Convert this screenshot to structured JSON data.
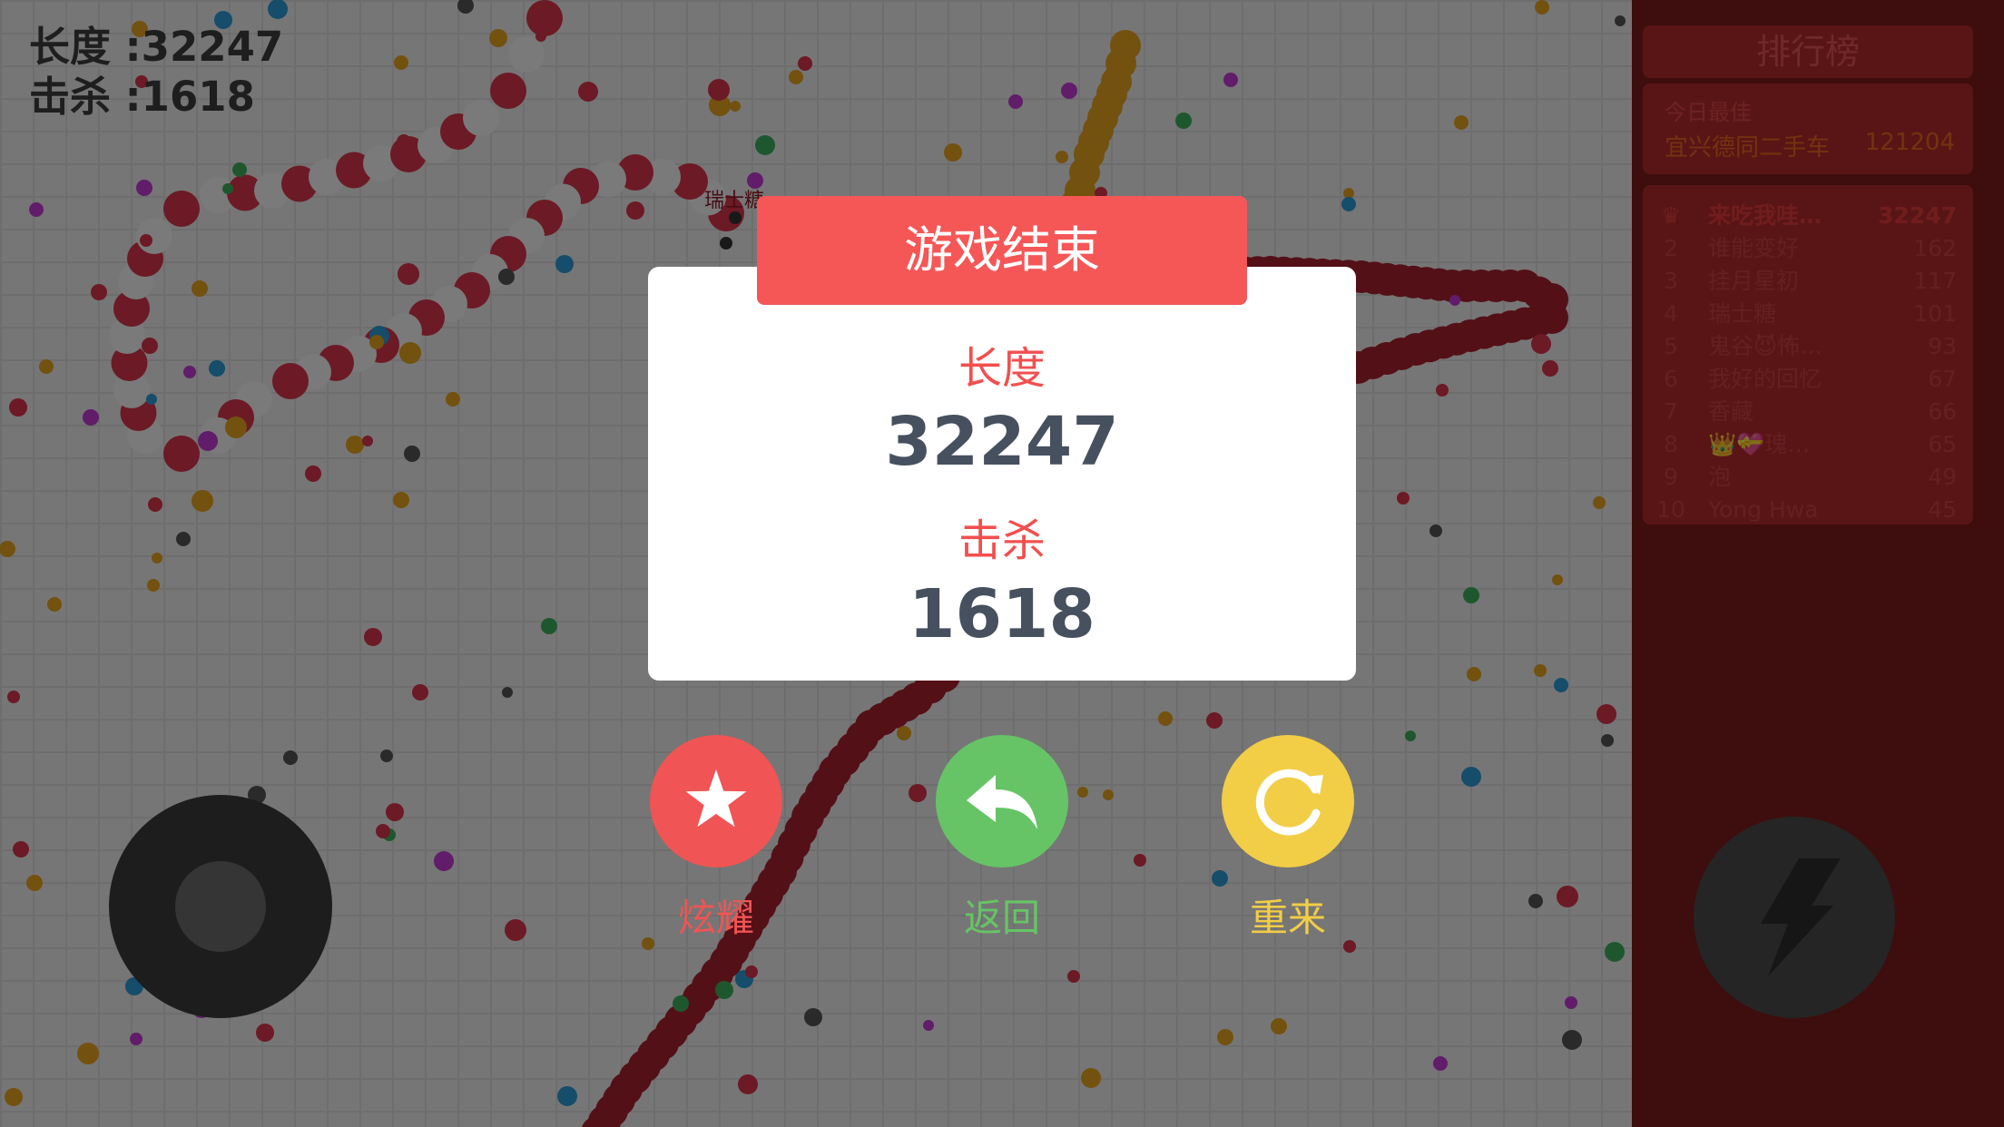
{
  "hud": {
    "length_label": "长度 :32247",
    "kills_label": "击杀 :1618"
  },
  "snake_name_tag": "瑞士糖",
  "leaderboard": {
    "title": "排行榜",
    "today_label": "今日最佳",
    "today_name": "宜兴德同二手车",
    "today_score": "121204",
    "entries": [
      {
        "rank": "1",
        "name": "来吃我哇…",
        "score": "32247"
      },
      {
        "rank": "2",
        "name": "谁能变好",
        "score": "162"
      },
      {
        "rank": "3",
        "name": "挂月星初",
        "score": "117"
      },
      {
        "rank": "4",
        "name": "瑞士糖",
        "score": "101"
      },
      {
        "rank": "5",
        "name": "鬼谷😈怖…",
        "score": "93"
      },
      {
        "rank": "6",
        "name": "我好的回忆",
        "score": "67"
      },
      {
        "rank": "7",
        "name": "香藏",
        "score": "66"
      },
      {
        "rank": "8",
        "name": "👑💝瑰…",
        "score": "65"
      },
      {
        "rank": "9",
        "name": "泡",
        "score": "49"
      },
      {
        "rank": "10",
        "name": "Yong Hwa",
        "score": "45"
      }
    ]
  },
  "result": {
    "title": "游戏结束",
    "length_label": "长度",
    "length_value": "32247",
    "kills_label": "击杀",
    "kills_value": "1618"
  },
  "actions": {
    "show_off": "炫耀",
    "back": "返回",
    "retry": "重来"
  },
  "colors": {
    "header": "#f55757",
    "label": "#f24f4f",
    "value": "#46505e",
    "show_off": "#f05454",
    "back": "#66c466",
    "retry": "#f2cd46"
  }
}
